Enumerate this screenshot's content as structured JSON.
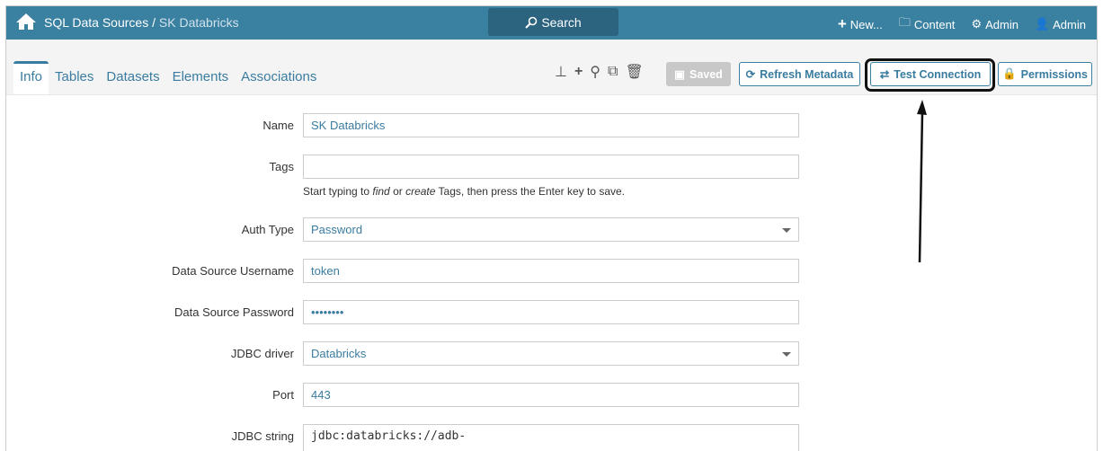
{
  "header": {
    "breadcrumb_parent": "SQL Data Sources",
    "breadcrumb_sep": " / ",
    "breadcrumb_current": "SK Databricks",
    "search_label": "Search",
    "new_label": "New...",
    "content_label": "Content",
    "admin_label": "Admin",
    "user_label": "Admin"
  },
  "tabs": [
    "Info",
    "Tables",
    "Datasets",
    "Elements",
    "Associations"
  ],
  "toolbar": {
    "saved": "Saved",
    "refresh": "Refresh Metadata",
    "test": "Test Connection",
    "permissions": "Permissions"
  },
  "form": {
    "name": {
      "label": "Name",
      "value": "SK Databricks"
    },
    "tags": {
      "label": "Tags",
      "value": "",
      "help_pre": "Start typing to ",
      "help_find": "find",
      "help_mid": " or ",
      "help_create": "create",
      "help_post": " Tags, then press the Enter key to save."
    },
    "auth": {
      "label": "Auth Type",
      "value": "Password"
    },
    "username": {
      "label": "Data Source Username",
      "value": "token"
    },
    "password": {
      "label": "Data Source Password",
      "value": "••••••••"
    },
    "driver": {
      "label": "JDBC driver",
      "value": "Databricks"
    },
    "port": {
      "label": "Port",
      "value": "443"
    },
    "jdbc": {
      "label": "JDBC string",
      "value": "jdbc:databricks://adb-"
    }
  }
}
